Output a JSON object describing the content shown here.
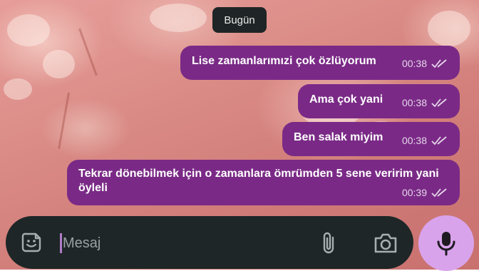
{
  "chat": {
    "date_label": "Bugün",
    "messages": [
      {
        "text": "Lise zamanlarımızi çok özlüyorum",
        "time": "00:38",
        "status": "read"
      },
      {
        "text": "Ama çok yani",
        "time": "00:38",
        "status": "read"
      },
      {
        "text": "Ben salak miyim",
        "time": "00:38",
        "status": "read"
      },
      {
        "text": "Tekrar dönebilmek için o zamanlara ömrümden 5 sene veririm yani öyleli",
        "time": "00:39",
        "status": "read"
      }
    ]
  },
  "composer": {
    "placeholder": "Mesaj",
    "icons": {
      "emoji": "sticker-smile-icon",
      "attach": "paperclip-icon",
      "camera": "camera-icon",
      "mic": "microphone-icon"
    }
  },
  "colors": {
    "bubble": "#7a2a86",
    "composer_bg": "#1e2627",
    "mic_button": "#d9a3ec",
    "date_chip": "#1f2526"
  }
}
